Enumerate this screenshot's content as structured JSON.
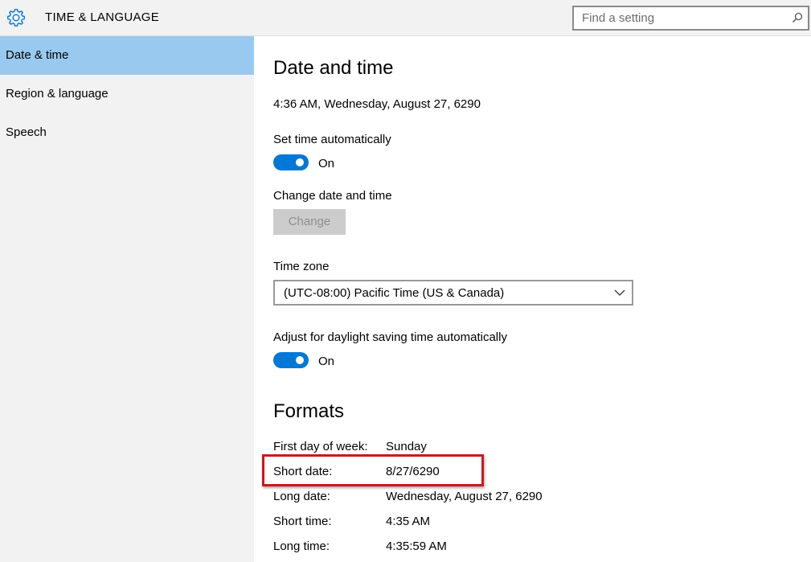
{
  "header": {
    "title": "TIME & LANGUAGE",
    "search_placeholder": "Find a setting"
  },
  "sidebar": {
    "items": [
      {
        "label": "Date & time",
        "selected": true
      },
      {
        "label": "Region & language",
        "selected": false
      },
      {
        "label": "Speech",
        "selected": false
      }
    ]
  },
  "main": {
    "heading": "Date and time",
    "current_datetime": "4:36 AM, Wednesday, August 27, 6290",
    "set_time_auto": {
      "label": "Set time automatically",
      "state": "On"
    },
    "change_section": {
      "label": "Change date and time",
      "button": "Change"
    },
    "time_zone": {
      "label": "Time zone",
      "value": "(UTC-08:00) Pacific Time (US & Canada)"
    },
    "dst": {
      "label": "Adjust for daylight saving time automatically",
      "state": "On"
    },
    "formats": {
      "heading": "Formats",
      "rows": [
        {
          "label": "First day of week:",
          "value": "Sunday"
        },
        {
          "label": "Short date:",
          "value": "8/27/6290"
        },
        {
          "label": "Long date:",
          "value": "Wednesday, August 27, 6290"
        },
        {
          "label": "Short time:",
          "value": "4:35 AM"
        },
        {
          "label": "Long time:",
          "value": "4:35:59 AM"
        }
      ]
    }
  },
  "colors": {
    "accent": "#0078d7",
    "sidebar_selected": "#99c9ef",
    "highlight": "#d0161c"
  },
  "icons": {
    "app": "gear-icon",
    "search": "search-icon",
    "dropdown": "chevron-down-icon"
  }
}
